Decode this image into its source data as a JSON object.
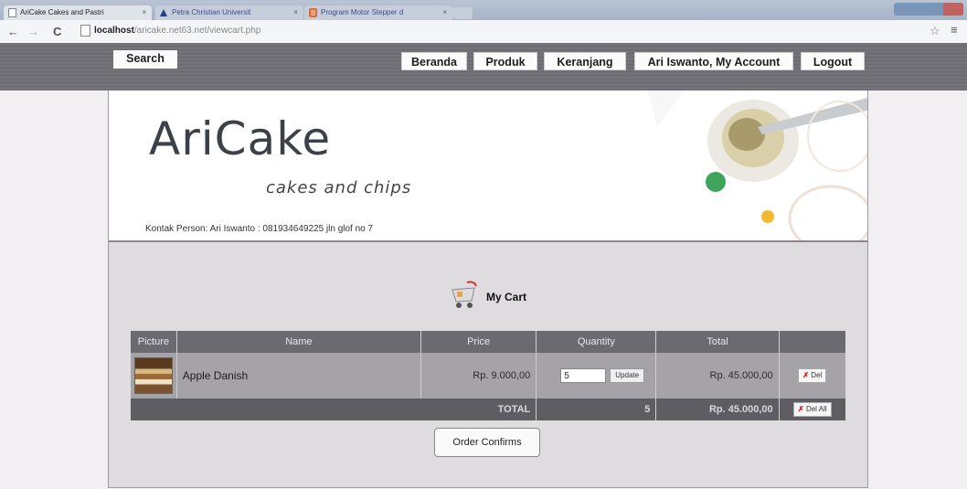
{
  "browser": {
    "tabs": [
      {
        "label": "AriCake Cakes and Pastri",
        "active": true
      },
      {
        "label": "Petra Christian Universit",
        "active": false
      },
      {
        "label": "Program Motor Stepper d",
        "active": false
      }
    ],
    "url_host": "localhost",
    "url_path": "/aricake.net63.net/viewcart.php"
  },
  "nav": {
    "search": "Search",
    "items": [
      "Beranda",
      "Produk",
      "Keranjang",
      "Ari Iswanto, My Account",
      "Logout"
    ]
  },
  "header": {
    "logo": "AriCake",
    "tagline": "cakes and chips",
    "contact": "Kontak Person: Ari Iswanto : 081934649225 jln glof no 7"
  },
  "cart": {
    "title": "My Cart",
    "columns": [
      "Picture",
      "Name",
      "Price",
      "Quantity",
      "Total",
      ""
    ],
    "items": [
      {
        "name": "Apple Danish",
        "price": "Rp. 9.000,00",
        "quantity": "5",
        "update_label": "Update",
        "total": "Rp. 45.000,00",
        "delete_label": "Del"
      }
    ],
    "total_label": "TOTAL",
    "total_quantity": "5",
    "total_amount": "Rp. 45.000,00",
    "delete_all_label": "Del All",
    "order_button": "Order Confirms"
  },
  "colors": {
    "nav_bg": "#6d6c72",
    "table_header": "#6a6a70",
    "row_bg": "#a6a3a8",
    "delete_x": "#dd1111"
  }
}
